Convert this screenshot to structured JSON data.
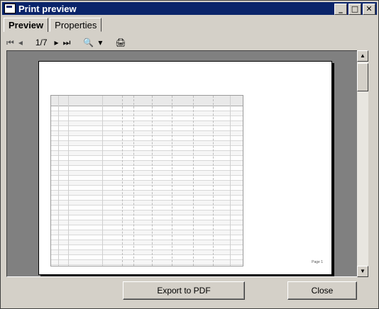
{
  "window": {
    "title": "Print preview",
    "controls": [
      "minimize-icon",
      "maximize-icon",
      "close-icon"
    ]
  },
  "tabs": [
    {
      "label": "Preview",
      "active": true
    },
    {
      "label": "Properties",
      "active": false
    }
  ],
  "toolbar": {
    "page_indicator": "1/7",
    "first_glyph": "⏮",
    "prev_glyph": "◂",
    "next_glyph": "▸",
    "last_glyph": "⏭",
    "zoom_glyph": "🔍",
    "dropdown_glyph": "▾",
    "print_glyph": "🖨"
  },
  "preview": {
    "footer_text": "Page 1"
  },
  "buttons": {
    "export": "Export to PDF",
    "close": "Close"
  }
}
